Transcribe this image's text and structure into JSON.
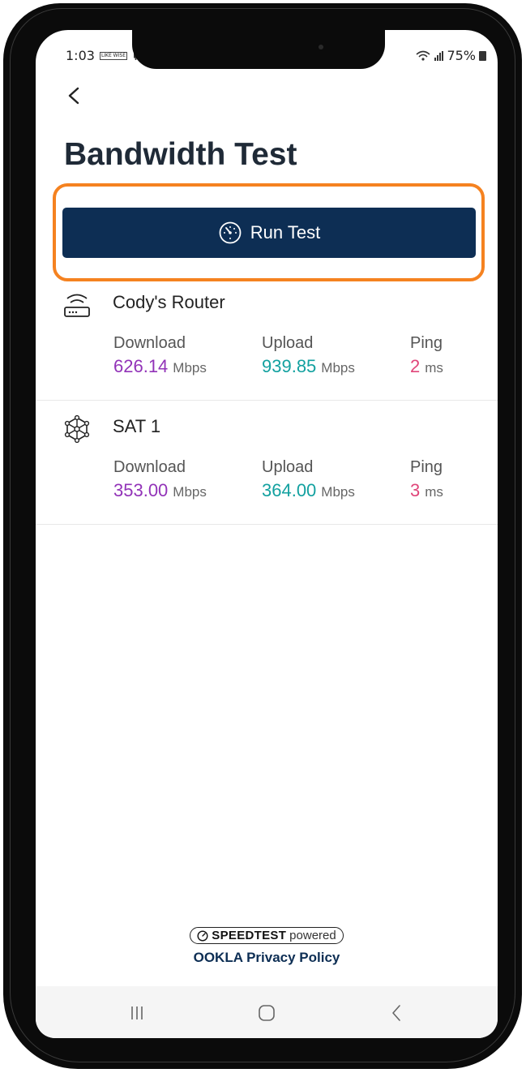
{
  "status_bar": {
    "time": "1:03",
    "carrier_badge": "LIKE WISE",
    "battery": "75%"
  },
  "header": {
    "back_icon": "chevron-left-icon",
    "title": "Bandwidth Test"
  },
  "run_test": {
    "icon": "speedometer-icon",
    "label": "Run Test",
    "highlight_color": "#f58220",
    "button_color": "#0d2e54"
  },
  "devices": [
    {
      "icon": "router-icon",
      "name": "Cody's Router",
      "download_label": "Download",
      "download_value": "626.14",
      "download_unit": "Mbps",
      "upload_label": "Upload",
      "upload_value": "939.85",
      "upload_unit": "Mbps",
      "ping_label": "Ping",
      "ping_value": "2",
      "ping_unit": "ms"
    },
    {
      "icon": "mesh-network-icon",
      "name": "SAT 1",
      "download_label": "Download",
      "download_value": "353.00",
      "download_unit": "Mbps",
      "upload_label": "Upload",
      "upload_value": "364.00",
      "upload_unit": "Mbps",
      "ping_label": "Ping",
      "ping_value": "3",
      "ping_unit": "ms"
    }
  ],
  "colors": {
    "download": "#9233b8",
    "upload": "#13a1a0",
    "ping": "#e0467a"
  },
  "footer": {
    "speedtest_brand": "SPEEDTEST",
    "speedtest_suffix": "powered",
    "privacy_link": "OOKLA Privacy Policy"
  },
  "nav_bar": {
    "items": [
      "recent-apps-icon",
      "home-icon",
      "back-icon"
    ]
  }
}
